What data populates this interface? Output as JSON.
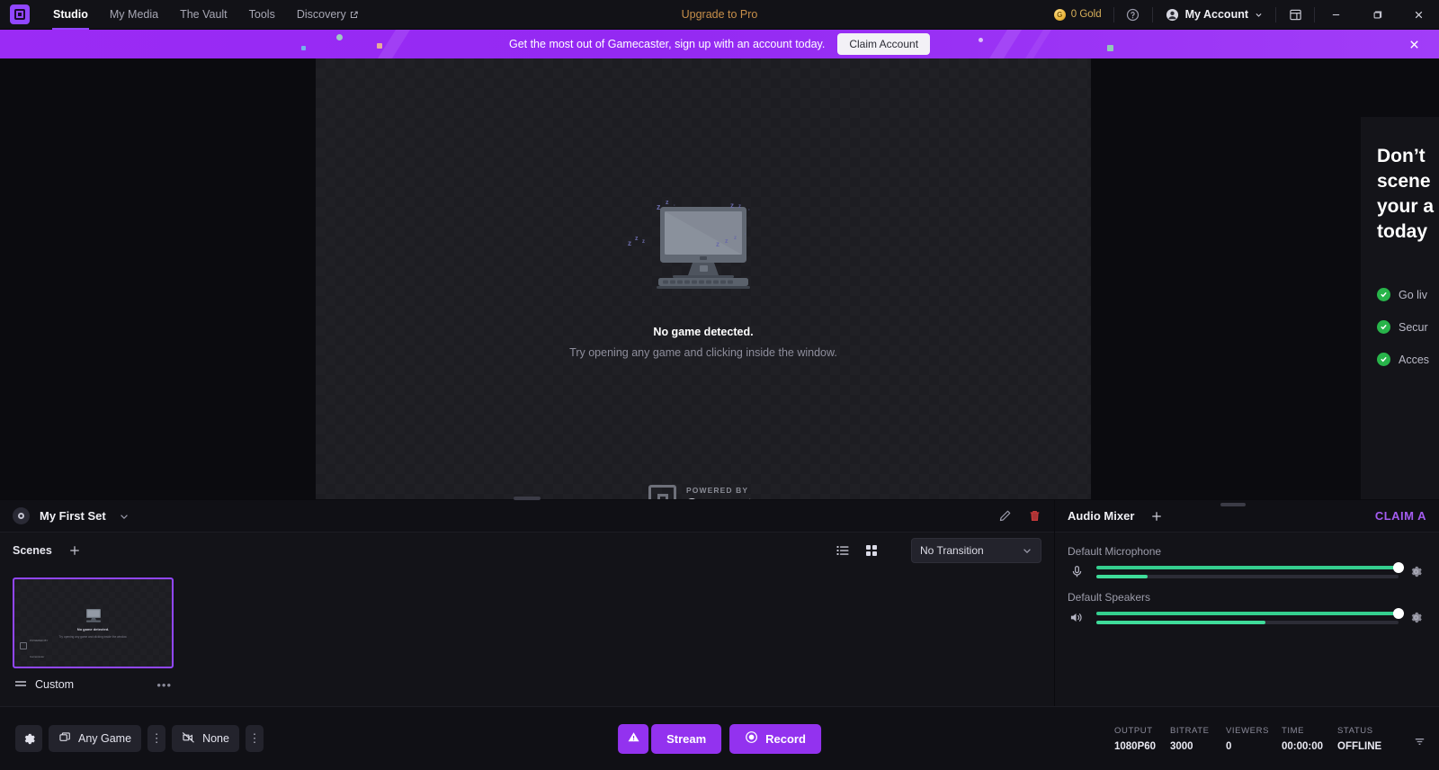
{
  "titlebar": {
    "logo": "gamecaster-logo-icon",
    "nav": [
      {
        "label": "Studio",
        "active": true,
        "external": false
      },
      {
        "label": "My Media",
        "active": false,
        "external": false
      },
      {
        "label": "The Vault",
        "active": false,
        "external": false
      },
      {
        "label": "Tools",
        "active": false,
        "external": false
      },
      {
        "label": "Discovery",
        "active": false,
        "external": true
      }
    ],
    "upgrade_label": "Upgrade to Pro",
    "gold_amount": "0 Gold",
    "gold_symbol": "G",
    "help_icon": "help-circle-icon",
    "account_label": "My Account",
    "layout_icon": "panel-layout-icon",
    "minimize_icon": "minimize-icon",
    "maximize_icon": "maximize-icon",
    "close_icon": "close-icon"
  },
  "banner": {
    "text": "Get the most out of Gamecaster, sign up with an account today.",
    "button_label": "Claim Account",
    "close_icon": "close-icon",
    "background": "#9b2bf5"
  },
  "preview": {
    "empty_title": "No game detected.",
    "empty_subtitle": "Try opening any game and clicking inside the window.",
    "zzz": "z",
    "watermark_sub": "POWERED BY",
    "watermark_name": "Gamecaster"
  },
  "promo": {
    "headline_lines": [
      "Don’t",
      "scene",
      "your a",
      "today"
    ],
    "features": [
      {
        "label": "Go liv"
      },
      {
        "label": "Secur"
      },
      {
        "label": "Acces"
      }
    ],
    "check_color": "#28b44a"
  },
  "scenes": {
    "set_name": "My First Set",
    "set_caret_icon": "chevron-down-icon",
    "edit_icon": "pencil-icon",
    "delete_icon": "trash-icon",
    "title": "Scenes",
    "add_icon": "plus-icon",
    "list_view_icon": "list-view-icon",
    "grid_view_icon": "grid-view-icon",
    "transition_value": "No Transition",
    "transition_caret_icon": "chevron-down-icon",
    "items": [
      {
        "label": "Custom",
        "selected": true,
        "drag_icon": "drag-handle-icon",
        "more_icon": "more-horizontal-icon",
        "thumb_title": "No game detected.",
        "thumb_sub": "Try opening any game and clicking inside the window.",
        "thumb_wm_sub": "POWERED BY",
        "thumb_wm_name": "Gamecaster"
      }
    ]
  },
  "mixer": {
    "title": "Audio Mixer",
    "add_icon": "plus-icon",
    "claim_label": "CLAIM A",
    "channels": [
      {
        "label": "Default Microphone",
        "icon": "microphone-icon",
        "volume": 100,
        "level": 17,
        "gear_icon": "gear-icon"
      },
      {
        "label": "Default Speakers",
        "icon": "speaker-icon",
        "volume": 100,
        "level": 56,
        "gear_icon": "gear-icon"
      }
    ],
    "slider_color": "#35cf8f"
  },
  "bottombar": {
    "settings_icon": "gear-icon",
    "game_source": {
      "label": "Any Game",
      "icon": "window-capture-icon",
      "kebab_icon": "kebab-menu-icon",
      "kebab_glyph": "⋮"
    },
    "camera_source": {
      "label": "None",
      "icon": "camera-off-icon",
      "kebab_icon": "kebab-menu-icon",
      "kebab_glyph": "⋮"
    },
    "warn_icon": "warning-triangle-icon",
    "stream_label": "Stream",
    "record_label": "Record",
    "record_icon": "record-circle-icon",
    "accent_color": "#9332ef",
    "stats": [
      {
        "key": "OUTPUT",
        "value": "1080P60"
      },
      {
        "key": "BITRATE",
        "value": "3000"
      },
      {
        "key": "VIEWERS",
        "value": "0"
      },
      {
        "key": "TIME",
        "value": "00:00:00"
      },
      {
        "key": "STATUS",
        "value": "OFFLINE"
      }
    ],
    "collapse_icon": "collapse-down-icon"
  }
}
